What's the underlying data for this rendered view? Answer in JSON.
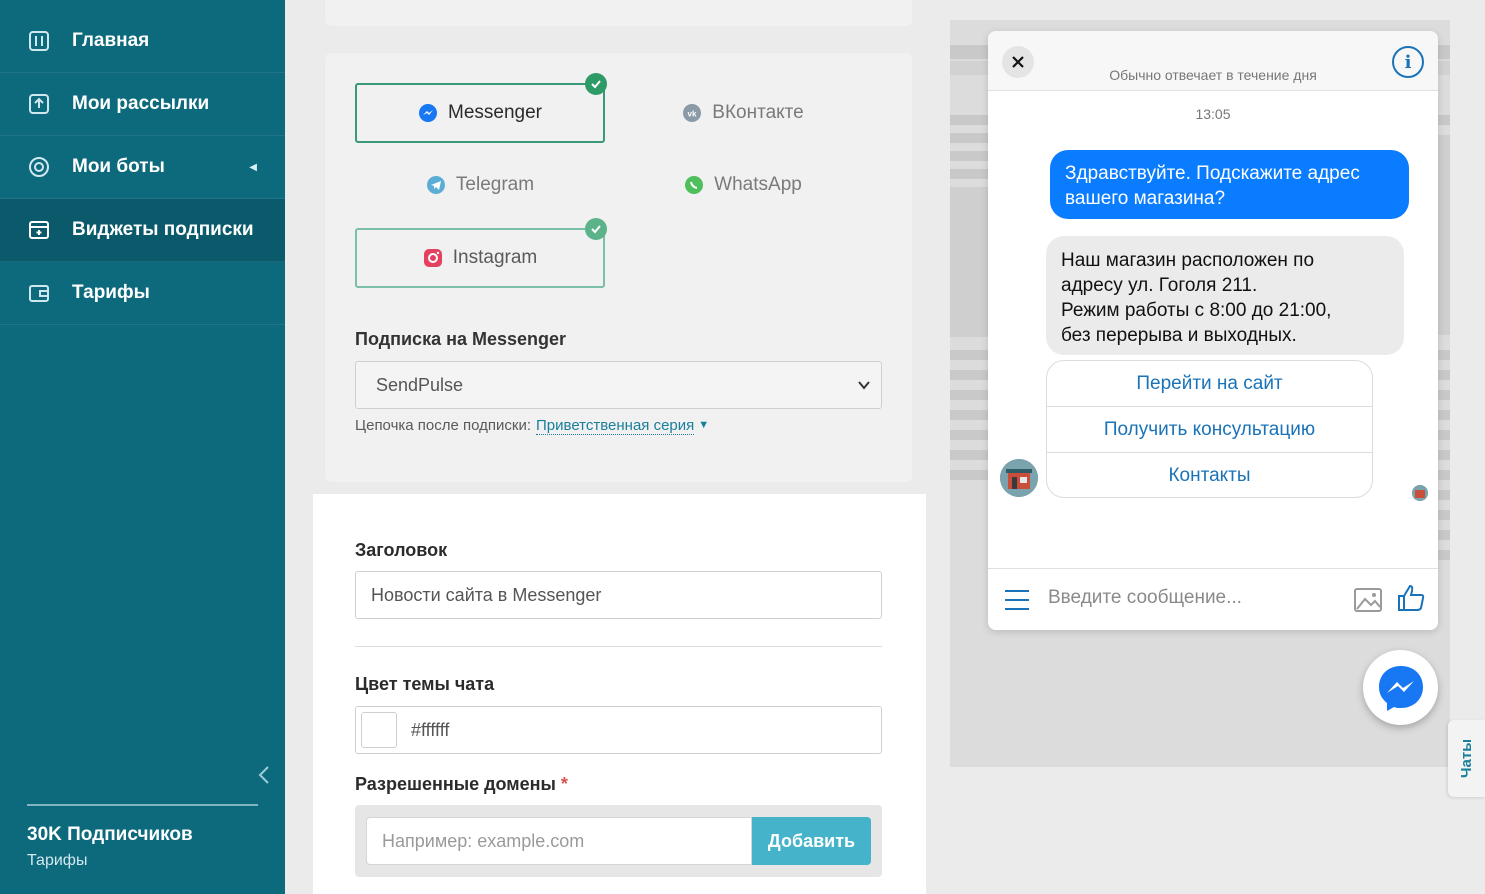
{
  "sidebar": {
    "items": [
      {
        "label": "Главная",
        "icon": "home-icon"
      },
      {
        "label": "Мои рассылки",
        "icon": "mailings-icon"
      },
      {
        "label": "Мои боты",
        "icon": "bots-icon"
      },
      {
        "label": "Виджеты подписки",
        "icon": "widgets-icon",
        "active": true
      },
      {
        "label": "Тарифы",
        "icon": "wallet-icon"
      }
    ],
    "subscribers": "30K Подписчиков",
    "tariff_link": "Тарифы"
  },
  "channels": {
    "items": [
      {
        "label": "Messenger",
        "selected": true
      },
      {
        "label": "ВКонтакте",
        "selected": false
      },
      {
        "label": "Telegram",
        "selected": false
      },
      {
        "label": "WhatsApp",
        "selected": false
      },
      {
        "label": "Instagram",
        "selected": true
      }
    ],
    "subscription_title": "Подписка на Messenger",
    "page_select_value": "SendPulse",
    "chain_label": "Цепочка после подписки:",
    "chain_value": "Приветственная серия"
  },
  "form": {
    "title_label": "Заголовок",
    "title_value": "Новости сайта в Messenger",
    "color_label": "Цвет темы чата",
    "color_value": "#ffffff",
    "domains_label": "Разрешенные домены",
    "required_mark": "*",
    "domain_placeholder": "Например: example.com",
    "add_button": "Добавить"
  },
  "preview": {
    "reply_time": "Обычно отвечает в течение дня",
    "message_time": "13:05",
    "user_message": "Здравствуйте. Подскажите адрес вашего магазина?",
    "bot_message_lines": [
      "Наш магазин расположен по",
      "адресу ул. Гоголя 211.",
      "Режим работы с 8:00 до 21:00,",
      "без перерыва и выходных."
    ],
    "quick_replies": [
      "Перейти на сайт",
      "Получить консультацию",
      "Контакты"
    ],
    "composer_placeholder": "Введите сообщение...",
    "info_glyph": "i"
  },
  "chats_tab": "Чаты",
  "colors": {
    "sidebar": "#0d6a7d",
    "accent": "#45b3c9",
    "check": "#2e9a66",
    "messenger_blue": "#0a7cff"
  }
}
